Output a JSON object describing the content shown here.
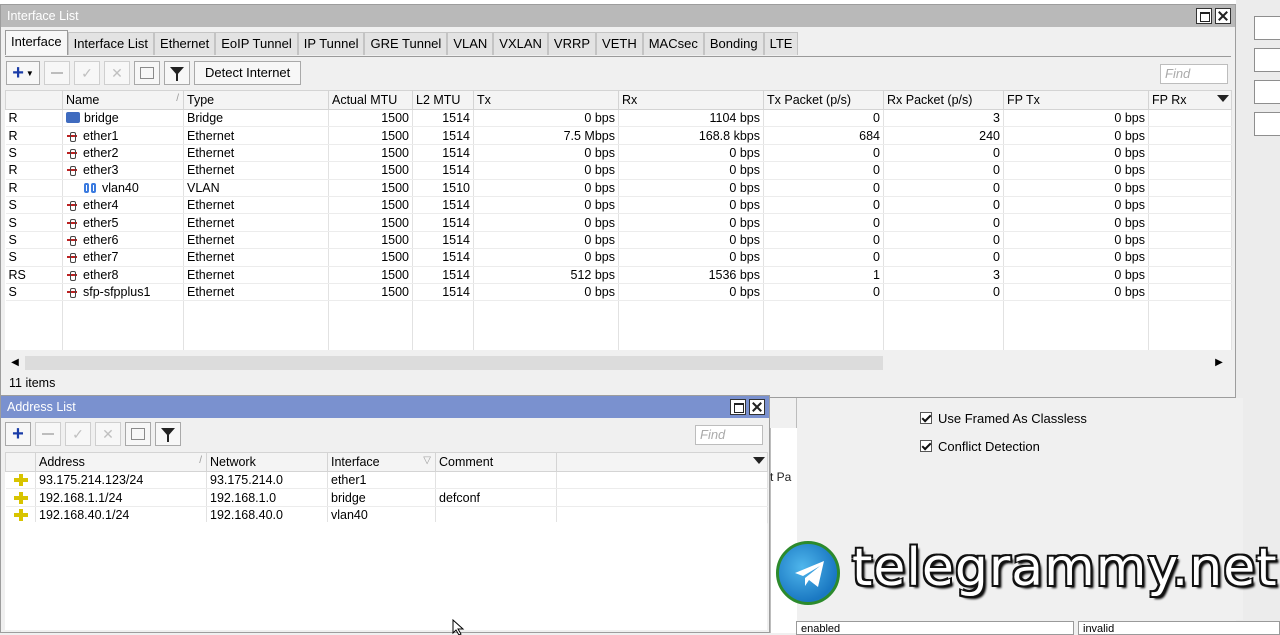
{
  "interface_window": {
    "title": "Interface List",
    "tabs": [
      "Interface",
      "Interface List",
      "Ethernet",
      "EoIP Tunnel",
      "IP Tunnel",
      "GRE Tunnel",
      "VLAN",
      "VXLAN",
      "VRRP",
      "VETH",
      "MACsec",
      "Bonding",
      "LTE"
    ],
    "active_tab": "Interface",
    "toolbar": {
      "detect_internet": "Detect Internet",
      "find_placeholder": "Find"
    },
    "columns": [
      "",
      "Name",
      "Type",
      "Actual MTU",
      "L2 MTU",
      "Tx",
      "Rx",
      "Tx Packet (p/s)",
      "Rx Packet (p/s)",
      "FP Tx",
      "FP Rx"
    ],
    "rows": [
      {
        "flag": "R",
        "icon": "bridge-icon",
        "indent": false,
        "name": "bridge",
        "type": "Bridge",
        "mtu": "1500",
        "l2mtu": "1514",
        "tx": "0 bps",
        "rx": "1104 bps",
        "txp": "0",
        "rxp": "3",
        "fptx": "0 bps",
        "fprx": ""
      },
      {
        "flag": "R",
        "icon": "ethernet-icon",
        "indent": false,
        "name": "ether1",
        "type": "Ethernet",
        "mtu": "1500",
        "l2mtu": "1514",
        "tx": "7.5 Mbps",
        "rx": "168.8 kbps",
        "txp": "684",
        "rxp": "240",
        "fptx": "0 bps",
        "fprx": ""
      },
      {
        "flag": "S",
        "icon": "ethernet-icon",
        "indent": false,
        "name": "ether2",
        "type": "Ethernet",
        "mtu": "1500",
        "l2mtu": "1514",
        "tx": "0 bps",
        "rx": "0 bps",
        "txp": "0",
        "rxp": "0",
        "fptx": "0 bps",
        "fprx": ""
      },
      {
        "flag": "R",
        "icon": "ethernet-icon",
        "indent": false,
        "name": "ether3",
        "type": "Ethernet",
        "mtu": "1500",
        "l2mtu": "1514",
        "tx": "0 bps",
        "rx": "0 bps",
        "txp": "0",
        "rxp": "0",
        "fptx": "0 bps",
        "fprx": ""
      },
      {
        "flag": "R",
        "icon": "vlan-icon",
        "indent": true,
        "name": "vlan40",
        "type": "VLAN",
        "mtu": "1500",
        "l2mtu": "1510",
        "tx": "0 bps",
        "rx": "0 bps",
        "txp": "0",
        "rxp": "0",
        "fptx": "0 bps",
        "fprx": ""
      },
      {
        "flag": "S",
        "icon": "ethernet-icon",
        "indent": false,
        "name": "ether4",
        "type": "Ethernet",
        "mtu": "1500",
        "l2mtu": "1514",
        "tx": "0 bps",
        "rx": "0 bps",
        "txp": "0",
        "rxp": "0",
        "fptx": "0 bps",
        "fprx": ""
      },
      {
        "flag": "S",
        "icon": "ethernet-icon",
        "indent": false,
        "name": "ether5",
        "type": "Ethernet",
        "mtu": "1500",
        "l2mtu": "1514",
        "tx": "0 bps",
        "rx": "0 bps",
        "txp": "0",
        "rxp": "0",
        "fptx": "0 bps",
        "fprx": ""
      },
      {
        "flag": "S",
        "icon": "ethernet-icon",
        "indent": false,
        "name": "ether6",
        "type": "Ethernet",
        "mtu": "1500",
        "l2mtu": "1514",
        "tx": "0 bps",
        "rx": "0 bps",
        "txp": "0",
        "rxp": "0",
        "fptx": "0 bps",
        "fprx": ""
      },
      {
        "flag": "S",
        "icon": "ethernet-icon",
        "indent": false,
        "name": "ether7",
        "type": "Ethernet",
        "mtu": "1500",
        "l2mtu": "1514",
        "tx": "0 bps",
        "rx": "0 bps",
        "txp": "0",
        "rxp": "0",
        "fptx": "0 bps",
        "fprx": ""
      },
      {
        "flag": "RS",
        "icon": "ethernet-icon",
        "indent": false,
        "name": "ether8",
        "type": "Ethernet",
        "mtu": "1500",
        "l2mtu": "1514",
        "tx": "512 bps",
        "rx": "1536 bps",
        "txp": "1",
        "rxp": "3",
        "fptx": "0 bps",
        "fprx": ""
      },
      {
        "flag": "S",
        "icon": "ethernet-icon",
        "indent": false,
        "name": "sfp-sfpplus1",
        "type": "Ethernet",
        "mtu": "1500",
        "l2mtu": "1514",
        "tx": "0 bps",
        "rx": "0 bps",
        "txp": "0",
        "rxp": "0",
        "fptx": "0 bps",
        "fprx": ""
      }
    ],
    "status": "11 items"
  },
  "address_window": {
    "title": "Address List",
    "find_placeholder": "Find",
    "columns": [
      "Address",
      "Network",
      "Interface",
      "Comment"
    ],
    "rows": [
      {
        "address": "93.175.214.123/24",
        "network": "93.175.214.0",
        "interface": "ether1",
        "comment": ""
      },
      {
        "address": "192.168.1.1/24",
        "network": "192.168.1.0",
        "interface": "bridge",
        "comment": "defconf"
      },
      {
        "address": "192.168.40.1/24",
        "network": "192.168.40.0",
        "interface": "vlan40",
        "comment": ""
      }
    ]
  },
  "background_panel": {
    "checkboxes": [
      {
        "label": "Use Framed As Classless",
        "checked": true
      },
      {
        "label": "Conflict Detection",
        "checked": true
      }
    ],
    "sliver_text": "t Pa",
    "bottom_fields": [
      "enabled",
      "invalid"
    ]
  },
  "watermark": {
    "text": "telegrammy.net"
  },
  "colors": {
    "active_titlebar": "#7a91cf",
    "inactive_titlebar": "#b9b9b9",
    "accent_plus": "#1a3ca8"
  }
}
